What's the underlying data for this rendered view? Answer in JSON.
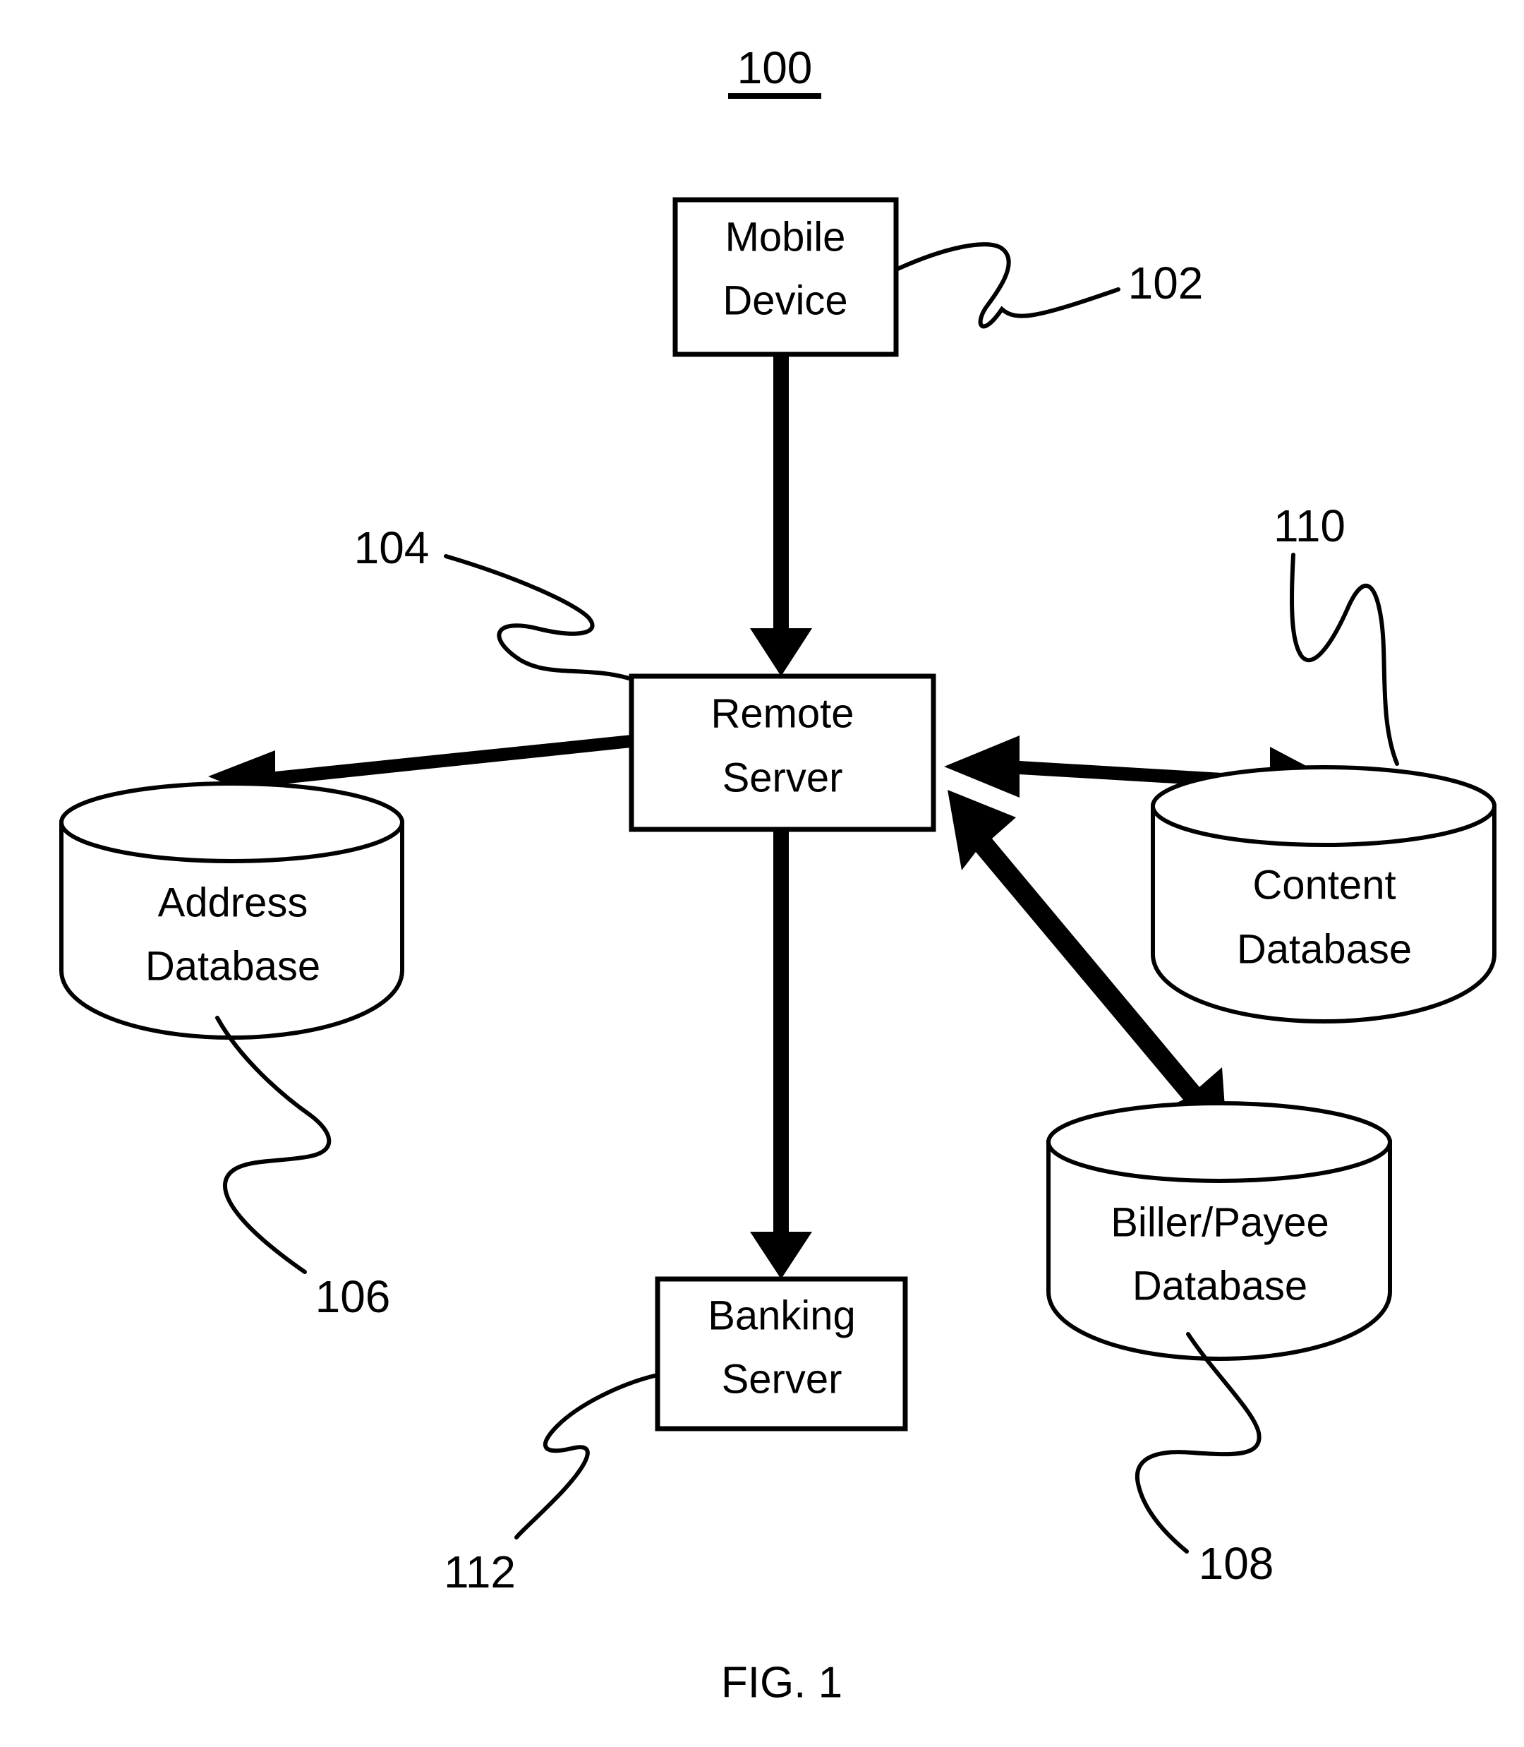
{
  "figure": {
    "number_label": "100",
    "caption": "FIG. 1"
  },
  "nodes": {
    "mobile_device": {
      "line1": "Mobile",
      "line2": "Device",
      "ref": "102",
      "shape": "rectangle"
    },
    "remote_server": {
      "line1": "Remote",
      "line2": "Server",
      "ref": "104",
      "shape": "rectangle"
    },
    "address_database": {
      "line1": "Address",
      "line2": "Database",
      "ref": "106",
      "shape": "cylinder"
    },
    "content_database": {
      "line1": "Content",
      "line2": "Database",
      "ref": "110",
      "shape": "cylinder"
    },
    "biller_payee_database": {
      "line1": "Biller/Payee",
      "line2": "Database",
      "ref": "108",
      "shape": "cylinder"
    },
    "banking_server": {
      "line1": "Banking",
      "line2": "Server",
      "ref": "112",
      "shape": "rectangle"
    }
  },
  "connections": [
    {
      "from": "mobile_device",
      "to": "remote_server",
      "style": "single-arrow-down"
    },
    {
      "from": "remote_server",
      "to": "address_database",
      "style": "double-arrow"
    },
    {
      "from": "remote_server",
      "to": "content_database",
      "style": "double-arrow"
    },
    {
      "from": "remote_server",
      "to": "biller_payee_database",
      "style": "double-arrow"
    },
    {
      "from": "remote_server",
      "to": "banking_server",
      "style": "single-arrow-down"
    }
  ],
  "colors": {
    "stroke": "#000000",
    "fill": "#ffffff"
  }
}
